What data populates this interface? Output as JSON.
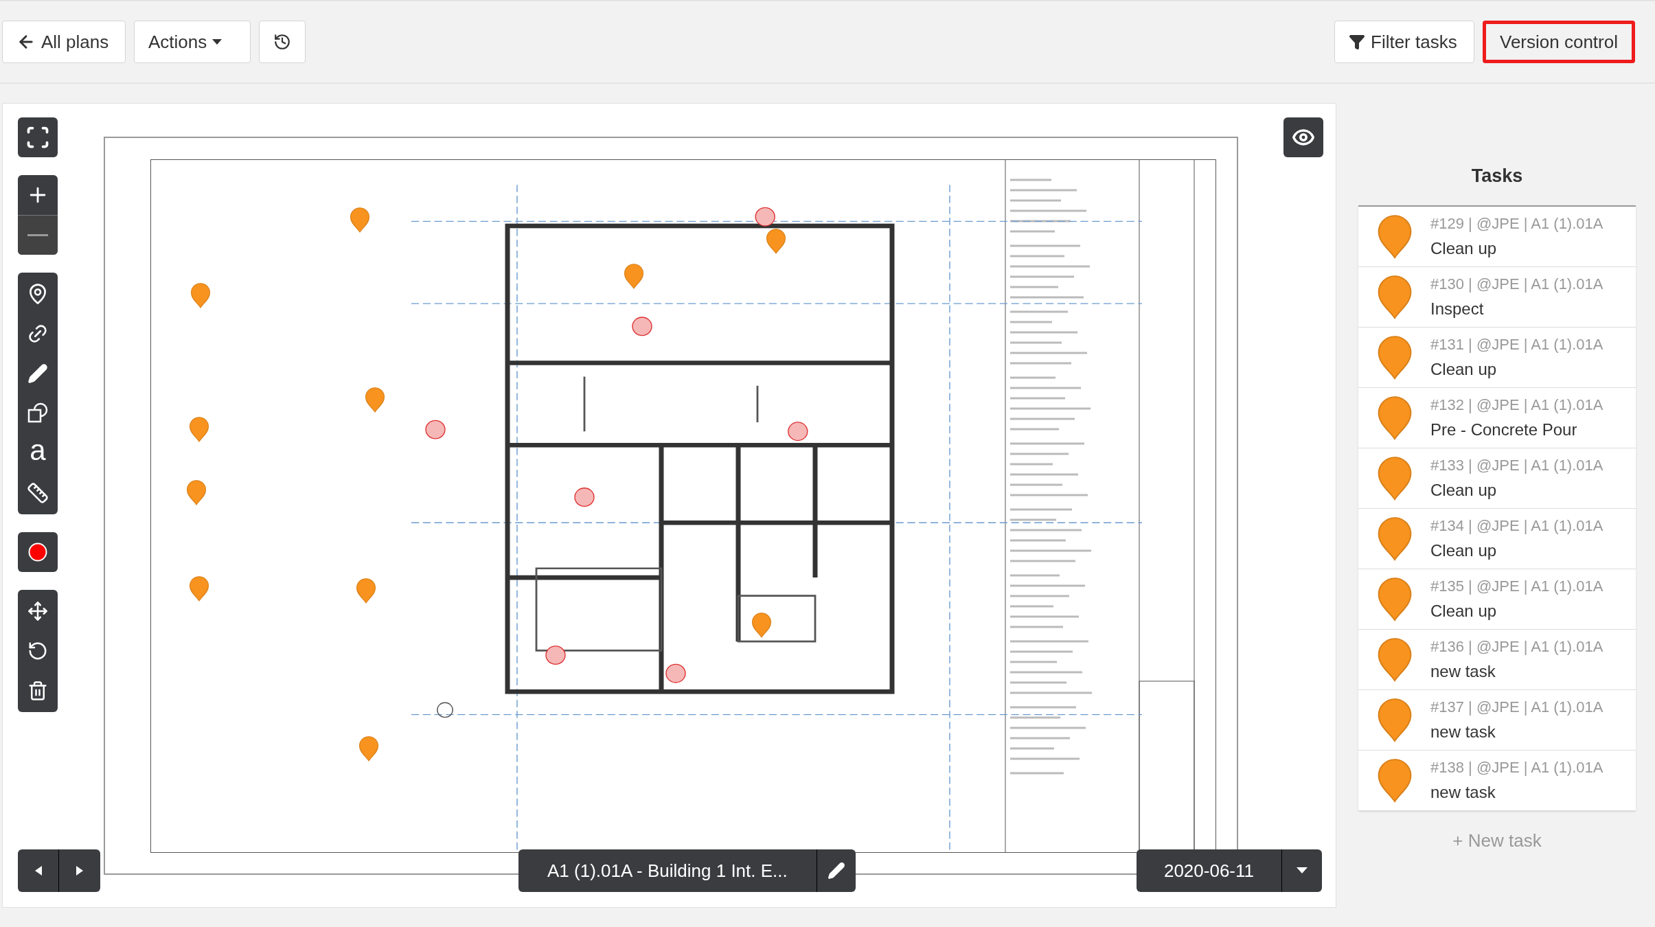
{
  "toolbar": {
    "back": {
      "label": "All plans"
    },
    "actions": {
      "label": "Actions"
    },
    "filter": {
      "label": "Filter tasks"
    },
    "version_control": {
      "label": "Version control",
      "highlighted": true
    }
  },
  "tools": {
    "text_glyph": "a"
  },
  "tasks": {
    "title": "Tasks",
    "items": [
      {
        "meta": "#129 | @JPE | A1 (1).01A",
        "title": "Clean up"
      },
      {
        "meta": "#130 | @JPE | A1 (1).01A",
        "title": "Inspect"
      },
      {
        "meta": "#131 | @JPE | A1 (1).01A",
        "title": "Clean up"
      },
      {
        "meta": "#132 | @JPE | A1 (1).01A",
        "title": "Pre - Concrete Pour"
      },
      {
        "meta": "#133 | @JPE | A1 (1).01A",
        "title": "Clean up"
      },
      {
        "meta": "#134 | @JPE | A1 (1).01A",
        "title": "Clean up"
      },
      {
        "meta": "#135 | @JPE | A1 (1).01A",
        "title": "Clean up"
      },
      {
        "meta": "#136 | @JPE | A1 (1).01A",
        "title": "new task"
      },
      {
        "meta": "#137 | @JPE | A1 (1).01A",
        "title": "new task"
      },
      {
        "meta": "#138 | @JPE | A1 (1).01A",
        "title": "new task"
      }
    ],
    "new_task": "+ New task"
  },
  "plan": {
    "name": "A1 (1).01A - Building 1 Int. E...",
    "date": "2020-06-11"
  }
}
